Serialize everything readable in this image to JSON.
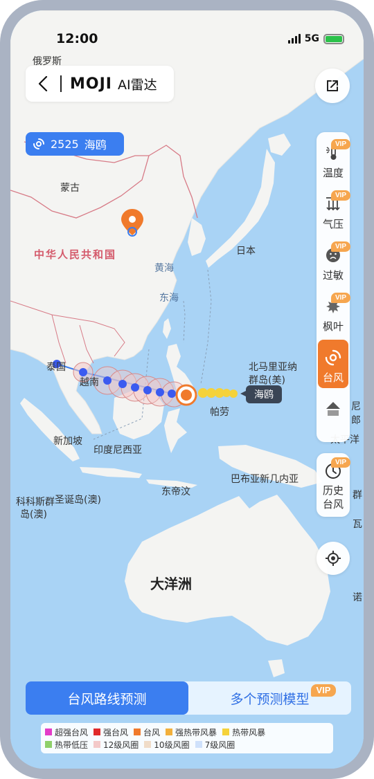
{
  "status": {
    "time": "12:00",
    "network": "5G"
  },
  "header": {
    "brand": "MOJI",
    "product": "AI雷达"
  },
  "typhoon_tag": {
    "code": "2525",
    "name": "海鸥"
  },
  "track_label": "海鸥",
  "map_labels": {
    "russia": "俄罗斯",
    "mongolia": "蒙古",
    "china": "中华人民共和国",
    "japan": "日本",
    "yellow_sea": "黄海",
    "east_sea": "东海",
    "thailand": "泰国",
    "vietnam": "越南",
    "singapore": "新加坡",
    "indonesia": "印度尼西亚",
    "palau": "帕劳",
    "northern_mariana_1": "北马里亚纳",
    "northern_mariana_2": "群岛(美)",
    "png": "巴布亚新几内亚",
    "east_timor": "东帝汶",
    "cocos_1": "科科斯群",
    "cocos_2": "岛(澳)",
    "christmas": "圣诞岛(澳)",
    "oceania": "大洋洲",
    "right_edge_1": "尼",
    "right_edge_2": "郎",
    "right_edge_3": "太平洋",
    "right_edge_4": "群",
    "right_edge_5": "瓦",
    "right_edge_6": "诺"
  },
  "tools": [
    {
      "label": "温度",
      "icon": "thermometer-icon",
      "vip": "VIP"
    },
    {
      "label": "气压",
      "icon": "pressure-icon",
      "vip": "VIP"
    },
    {
      "label": "过敏",
      "icon": "allergy-face-icon",
      "vip": "VIP"
    },
    {
      "label": "枫叶",
      "icon": "maple-leaf-icon",
      "vip": "VIP"
    },
    {
      "label": "台风",
      "icon": "typhoon-icon"
    },
    {
      "label": "",
      "icon": "layer-icon"
    }
  ],
  "history": {
    "label_1": "历史",
    "label_2": "台风",
    "vip": "VIP"
  },
  "bottom_tabs": {
    "active": "台风路线预测",
    "inactive": "多个预测模型",
    "vip": "VIP"
  },
  "legend": [
    {
      "label": "超强台风",
      "color": "#e33cc8"
    },
    {
      "label": "强台风",
      "color": "#e02a2a"
    },
    {
      "label": "台风",
      "color": "#f07a2c"
    },
    {
      "label": "强热带风暴",
      "color": "#f2b03c"
    },
    {
      "label": "热带风暴",
      "color": "#f5d23a"
    },
    {
      "label": "热带低压",
      "color": "#8fd06a"
    },
    {
      "label": "12级风圈",
      "color": "#f3c9c9"
    },
    {
      "label": "10级风圈",
      "color": "#f0dcc8"
    },
    {
      "label": "7级风圈",
      "color": "#cfe1fb"
    }
  ],
  "colors": {
    "accent": "#3b7ef0",
    "ocean": "#a9d3f5",
    "land": "#f3f3f1",
    "typhoon_orange": "#f07a2c"
  }
}
